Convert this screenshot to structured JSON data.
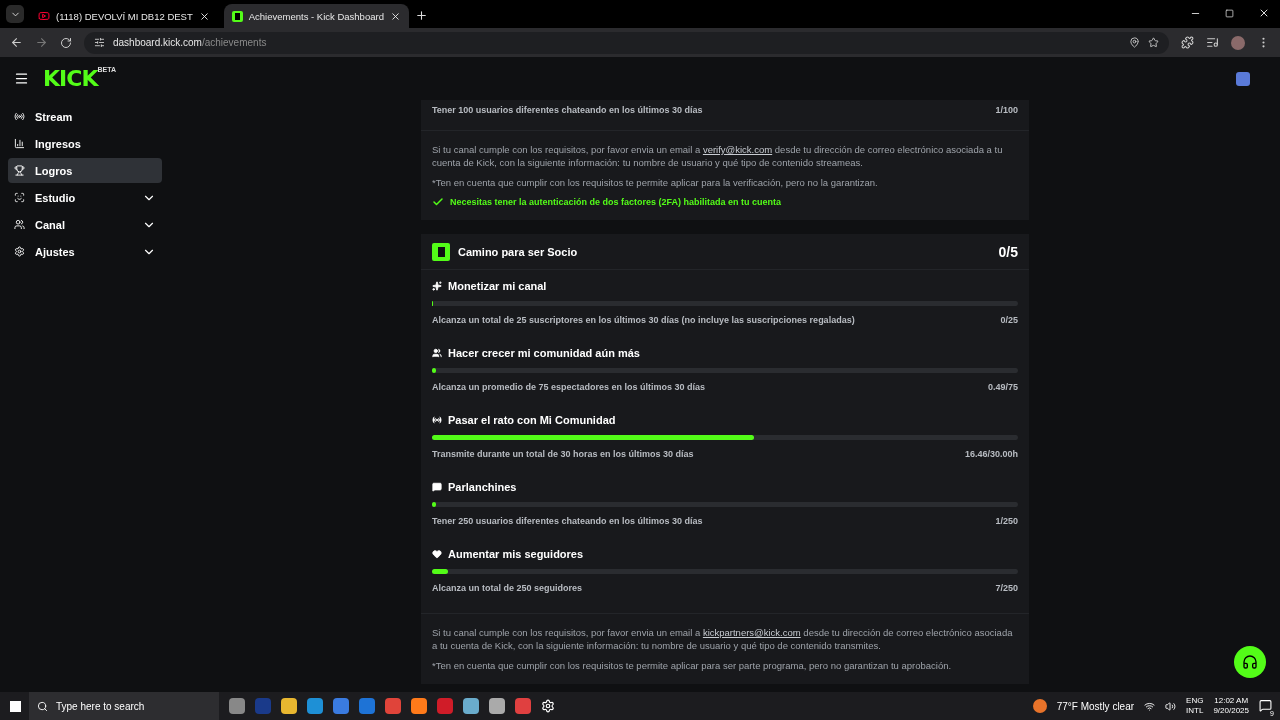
{
  "browser": {
    "tabs": [
      {
        "title": "(1118) DEVOLVÍ MI DB12 DEST",
        "kind": "video",
        "selected": false
      },
      {
        "title": "Achievements - Kick Dashboard",
        "kind": "kick",
        "selected": true
      }
    ],
    "url": {
      "host": "dashboard.kick.com",
      "path": "/achievements"
    }
  },
  "header": {
    "logo": "KICK",
    "badge": "BETA"
  },
  "sidebar": {
    "items": [
      {
        "label": "Stream",
        "kind": "stream",
        "selected": false,
        "expandable": false
      },
      {
        "label": "Ingresos",
        "kind": "chart",
        "selected": false,
        "expandable": false
      },
      {
        "label": "Logros",
        "kind": "trophy",
        "selected": true,
        "expandable": false
      },
      {
        "label": "Estudio",
        "kind": "studio",
        "selected": false,
        "expandable": true
      },
      {
        "label": "Canal",
        "kind": "users",
        "selected": false,
        "expandable": true
      },
      {
        "label": "Ajustes",
        "kind": "gear",
        "selected": false,
        "expandable": true
      }
    ]
  },
  "verification": {
    "last_goal": {
      "description": "Tener 100 usuarios diferentes chateando en los últimos 30 días",
      "reading": "1/100"
    },
    "note": {
      "before": "Si tu canal cumple con los requisitos, por favor envia un email a ",
      "link": "verify@kick.com",
      "after": " desde tu dirección de correo electrónico asociada a tu cuenta de Kick, con la siguiente información: tu nombre de usuario y qué tipo de contenido streameas."
    },
    "disclaimer": "*Ten en cuenta que cumplir con los requisitos te permite aplicar para la verificación, pero no la garantizan.",
    "requirement": {
      "text": "Necesitas tener la autenticación de dos factores (2FA) habilitada en tu cuenta",
      "met": true
    }
  },
  "partner": {
    "title": "Camino para ser Socio",
    "score": "0/5",
    "goals": [
      {
        "kind": "sparkle",
        "title": "Monetizar mi canal",
        "level": 0,
        "description": "Alcanza un total de 25 suscriptores en los últimos 30 días (no incluye las suscripciones regaladas)",
        "reading": "0/25"
      },
      {
        "kind": "community",
        "title": "Hacer crecer mi comunidad aún más",
        "level": 0.0065,
        "description": "Alcanza un promedio de 75 espectadores en los últimos 30 días",
        "reading": "0.49/75"
      },
      {
        "kind": "broadcast",
        "title": "Pasar el rato con Mi Comunidad",
        "level": 0.549,
        "description": "Transmite durante un total de 30 horas en los últimos 30 días",
        "reading": "16.46/30.00h"
      },
      {
        "kind": "chat",
        "title": "Parlanchines",
        "level": 0.004,
        "description": "Tener 250 usuarios diferentes chateando en los últimos 30 días",
        "reading": "1/250"
      },
      {
        "kind": "heart",
        "title": "Aumentar mis seguidores",
        "level": 0.028,
        "description": "Alcanza un total de 250 seguidores",
        "reading": "7/250"
      }
    ],
    "note": {
      "before": "Si tu canal cumple con los requisitos, por favor envia un email a ",
      "link": "kickpartners@kick.com",
      "after": " desde tu dirección de correo electrónico asociada a tu cuenta de Kick, con la siguiente información: tu nombre de usuario y qué tipo de contenido transmites."
    },
    "disclaimer": "*Ten en cuenta que cumplir con los requisitos te permite aplicar para ser parte programa, pero no garantizan tu aprobación."
  },
  "taskbar": {
    "search_placeholder": "Type here to search",
    "weather": "77°F  Mostly clear",
    "language": [
      "ENG",
      "INTL"
    ],
    "time": "12:02 AM",
    "date": "9/20/2025",
    "notifications": "9"
  }
}
